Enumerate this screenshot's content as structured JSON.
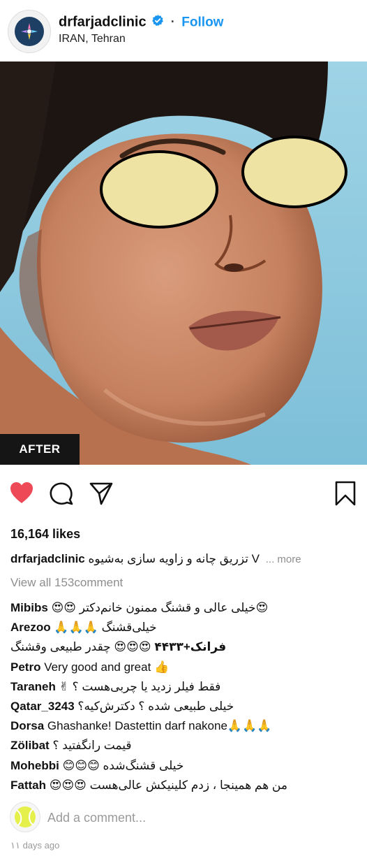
{
  "header": {
    "username": "drfarjadclinic",
    "follow_label": "Follow",
    "location": "IRAN, Tehran"
  },
  "photo": {
    "badge": "AFTER"
  },
  "actions": {
    "icons": [
      "heart-icon",
      "comment-icon",
      "share-icon",
      "bookmark-icon"
    ],
    "like_color": "#ed4956"
  },
  "post": {
    "likes": "16,164 likes",
    "caption_user": "drfarjadclinic",
    "caption_text": "تزریق چانه و زاویه سازی به‌شیوه V",
    "more_label": "... more",
    "view_all": "View all 153comment"
  },
  "comments": [
    {
      "user": "Mibibs",
      "text": "😍😍 خیلی عالی و قشنگ ممنون خانم‌دکتر😍"
    },
    {
      "user": "Arezoo",
      "text": "🙏🙏🙏 خیلی‌قشنگ"
    },
    {
      "user": "فرانک+۴۴۳۳",
      "text": "😍😍😍 چقدر طبیعی وقشنگ"
    },
    {
      "user": "Petro",
      "text": "Very good and great 👍"
    },
    {
      "user": "Taraneh",
      "text": "✌ فقط فیلر زدید یا چربی‌هست ؟"
    },
    {
      "user": "Qatar_3243",
      "text": "خیلی طبیعی شده ؟ دکترش‌کیه؟"
    },
    {
      "user": "Dorsa",
      "text": "Ghashanke! Dastettin darf nakone🙏🙏🙏"
    },
    {
      "user": "Zölibat",
      "text": "قیمت رانگفتید ؟"
    },
    {
      "user": "Mohebbi",
      "text": "😊😊😊 خیلی قشنگ‌شده"
    },
    {
      "user": "Fattah",
      "text": "😍😍😍 من هم همینجا ، زدم کلینیکش عالی‌هست"
    }
  ],
  "add_comment": {
    "placeholder": "Add a comment..."
  },
  "timestamp": "۱۱ days ago",
  "colors": {
    "accent": "#1a95f0",
    "muted": "#8e8e8e",
    "sky": "#8fc8dd"
  }
}
